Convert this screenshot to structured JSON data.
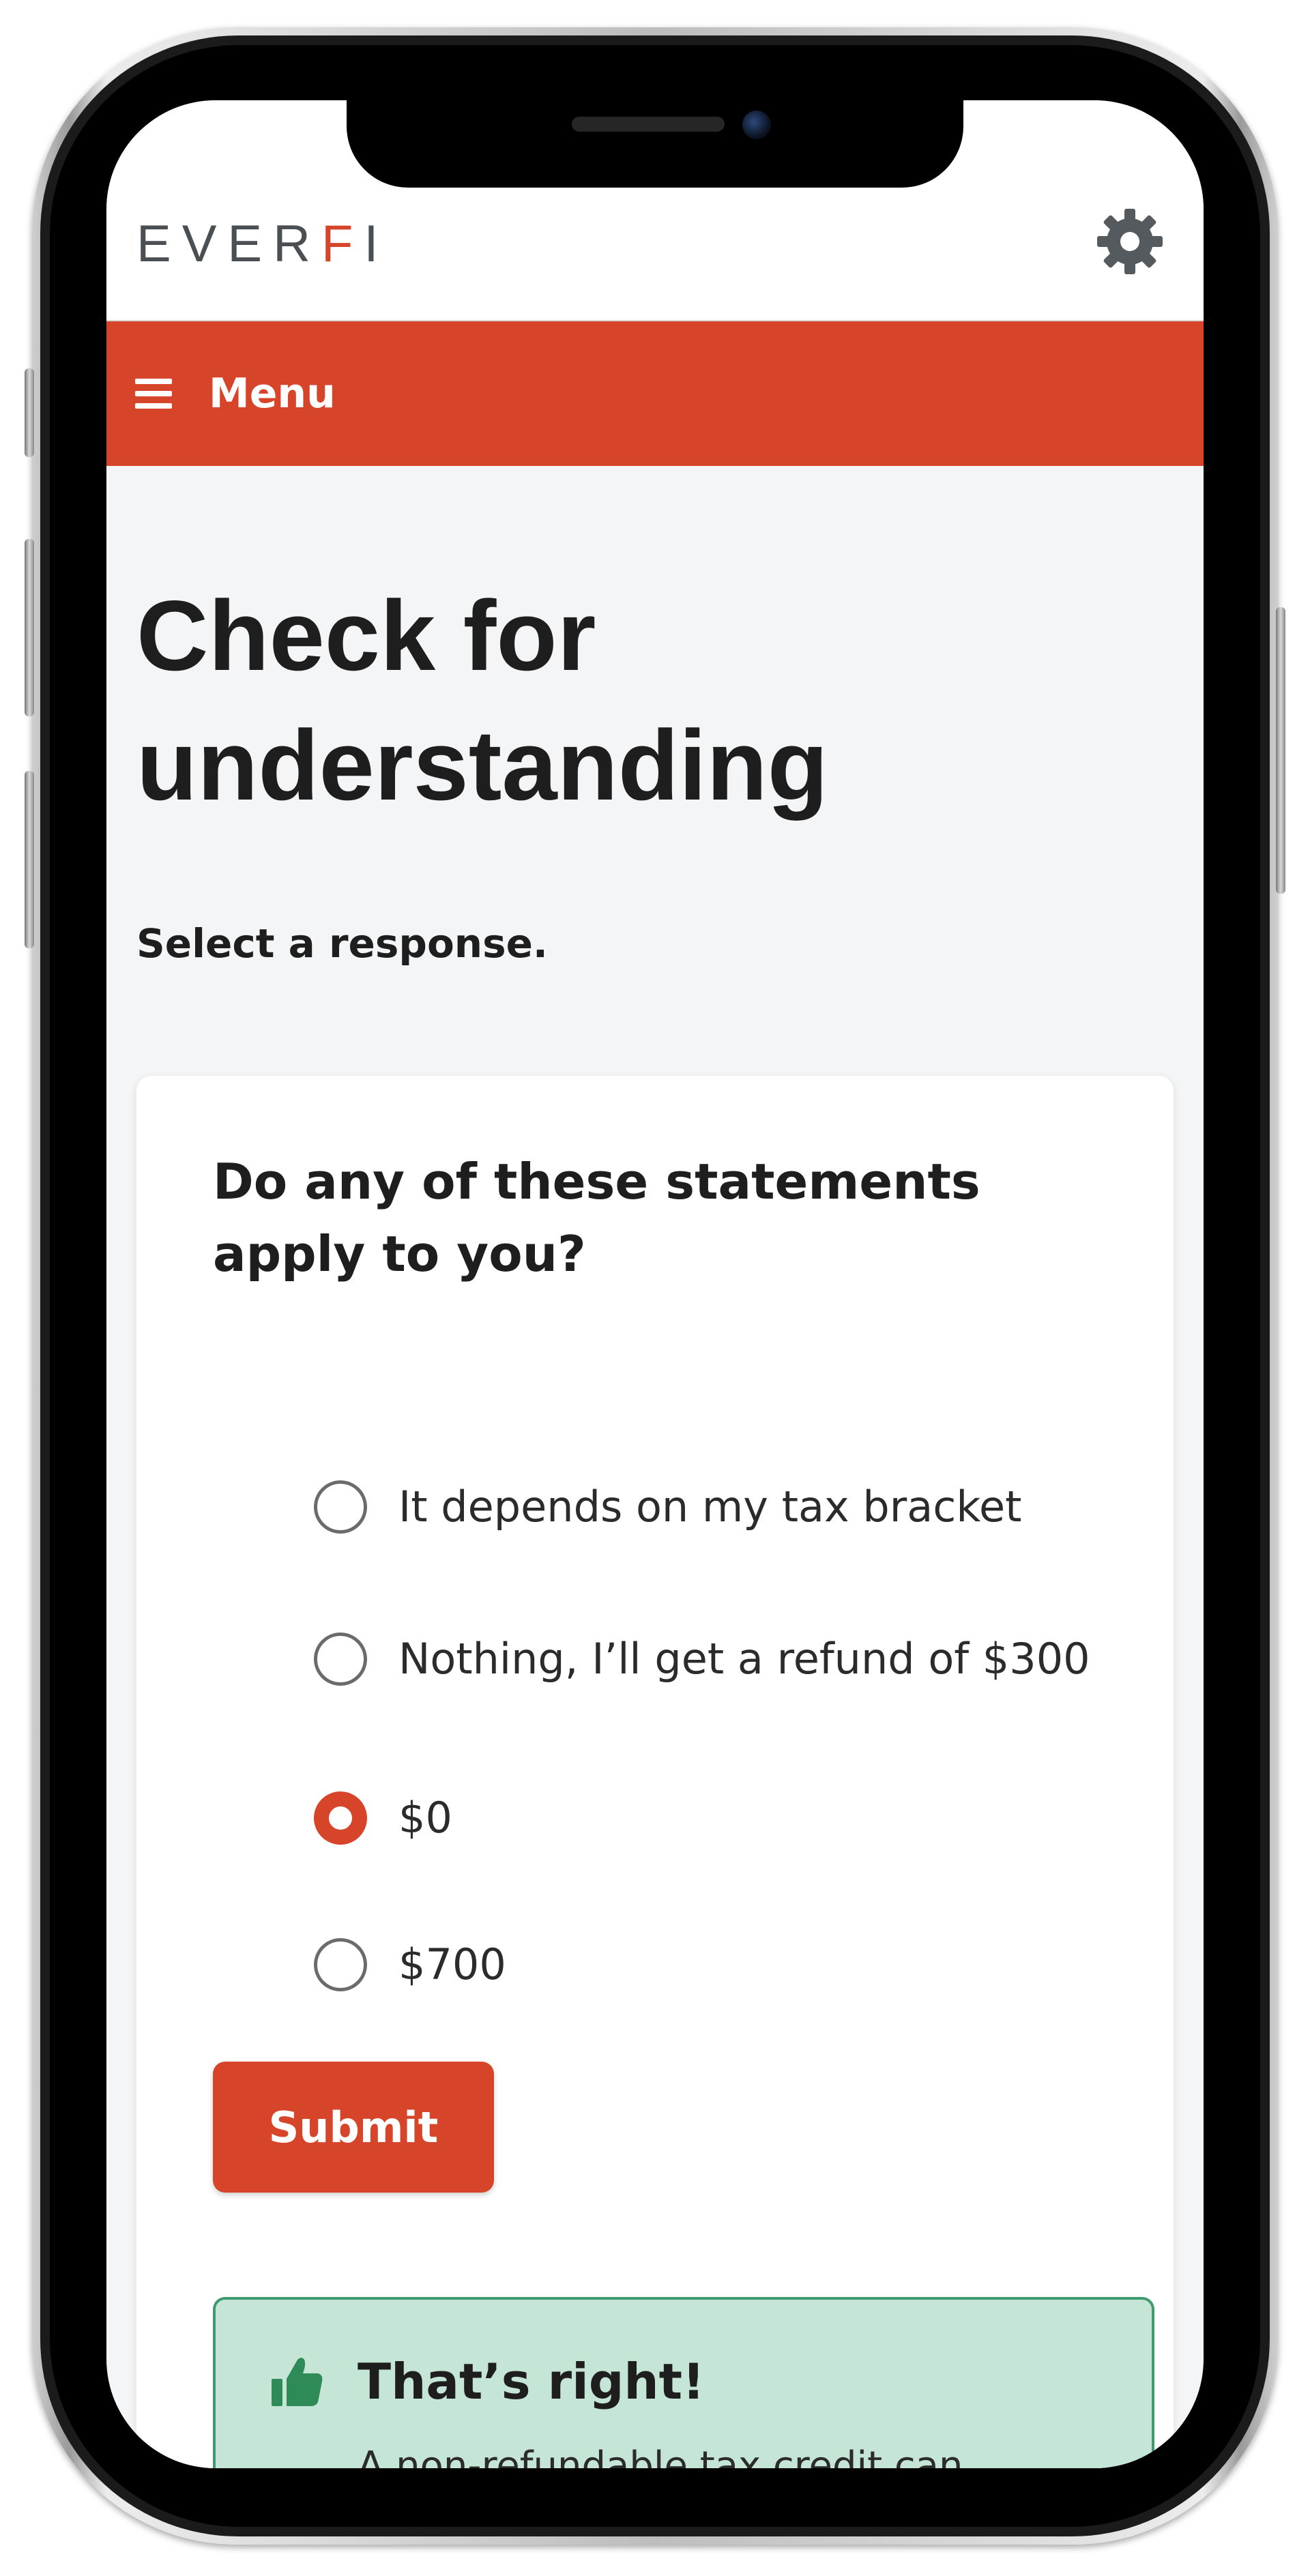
{
  "header": {
    "logo_text_start": "EVER",
    "logo_text_accent": "F",
    "logo_text_end": "I",
    "settings_icon": "gear-icon"
  },
  "menu": {
    "label": "Menu",
    "icon": "hamburger-icon"
  },
  "page": {
    "title": "Check for understanding",
    "instruction": "Select a response."
  },
  "question": {
    "text": "Do any of these statements apply to you?",
    "options": [
      {
        "label": "It depends on my tax bracket",
        "selected": false
      },
      {
        "label": "Nothing, I’ll get a refund of $300",
        "selected": false
      },
      {
        "label": "$0",
        "selected": true
      },
      {
        "label": "$700",
        "selected": false
      }
    ],
    "submit_label": "Submit"
  },
  "feedback": {
    "icon": "thumbs-up-icon",
    "title": "That’s right!",
    "body": "A non-refundable tax credit can only cancel out taxes you owe,"
  },
  "colors": {
    "brand_red": "#d6442a",
    "feedback_bg": "#c5e5d6",
    "feedback_border": "#3f9a70",
    "thumb_green": "#2e8b57"
  }
}
